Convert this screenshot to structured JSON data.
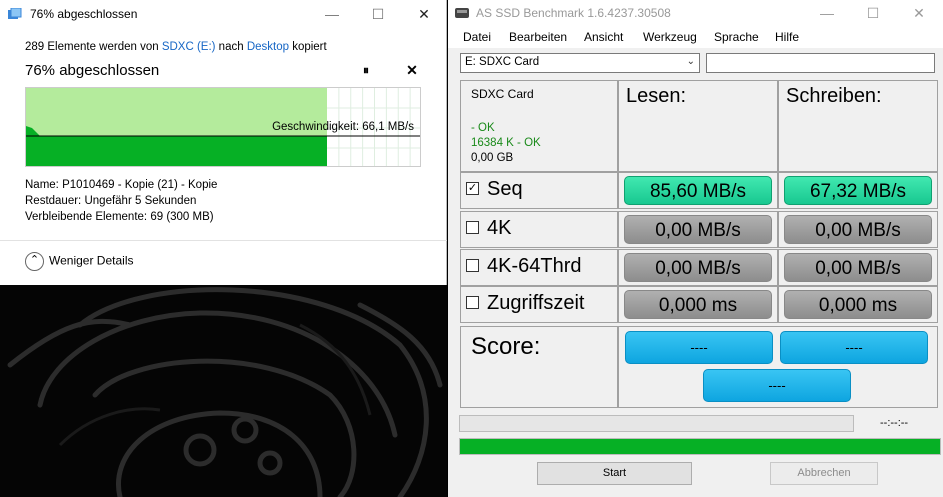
{
  "copy_dialog": {
    "title": "76% abgeschlossen",
    "copy_line": {
      "prefix": "289 Elemente werden von ",
      "source": "SDXC (E:)",
      "middle": " nach ",
      "destination": "Desktop",
      "suffix": " kopiert"
    },
    "percent_text": "76% abgeschlossen",
    "progress_fraction": 0.76,
    "pause_glyph": "⏸",
    "cancel_glyph": "✕",
    "speed_label": "Geschwindigkeit: 66,1 MB/s",
    "details": {
      "name_label": "Name:",
      "name_value": "P1010469 - Kopie (21) - Kopie",
      "remaining_label": "Restdauer:",
      "remaining_value": "Ungefähr 5 Sekunden",
      "items_label": "Verbleibende Elemente:",
      "items_value": "69 (300 MB)"
    },
    "less_details": "Weniger Details",
    "icons": {
      "app": "copy-icon",
      "pause": "pause-icon",
      "cancel": "close-icon",
      "details": "chevron-up-icon"
    },
    "colors": {
      "graph_fill": "#b4eb9c",
      "graph_speed": "#06b025",
      "link": "#1666c5"
    }
  },
  "asssd": {
    "title": "AS SSD Benchmark 1.6.4237.30508",
    "menu": [
      "Datei",
      "Bearbeiten",
      "Ansicht",
      "Werkzeug",
      "Sprache",
      "Hilfe"
    ],
    "drive_select": "E: SDXC Card",
    "drive_info": {
      "name": "SDXC Card",
      "line1": " - OK",
      "line2": "16384 K - OK",
      "line3": "0,00 GB"
    },
    "col_read": "Lesen:",
    "col_write": "Schreiben:",
    "rows": [
      {
        "label": "Seq",
        "checked": true,
        "read": "85,60 MB/s",
        "write": "67,32 MB/s"
      },
      {
        "label": "4K",
        "checked": false,
        "read": "0,00 MB/s",
        "write": "0,00 MB/s"
      },
      {
        "label": "4K-64Thrd",
        "checked": false,
        "read": "0,00 MB/s",
        "write": "0,00 MB/s"
      },
      {
        "label": "Zugriffszeit",
        "checked": false,
        "read": "0,000 ms",
        "write": "0,000 ms"
      }
    ],
    "score_label": "Score:",
    "score_read": "----",
    "score_write": "----",
    "score_total": "----",
    "time_label": "--:--:--",
    "progress_fraction": 1.0,
    "start": "Start",
    "stop": "Abbrechen",
    "colors": {
      "ok": "#1a8a1a",
      "green_result": "#2ad8a0",
      "score": "#1bb3ea",
      "progress": "#06b025"
    }
  }
}
